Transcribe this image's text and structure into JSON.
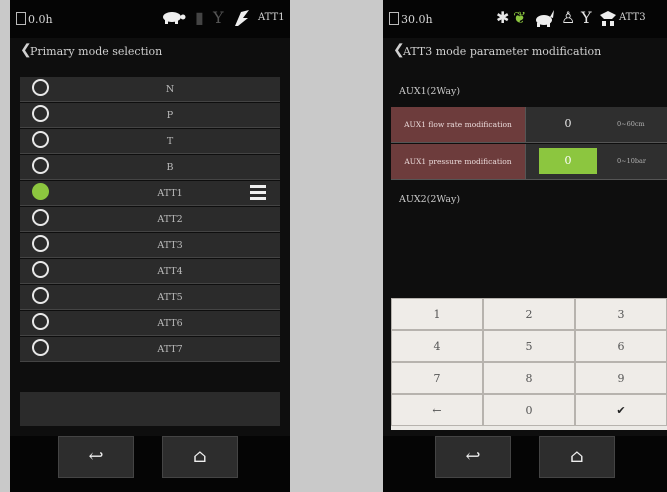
{
  "left": {
    "status": {
      "hours": "0.0h",
      "mode_tag": "ATT1",
      "icons": [
        "turtle-icon",
        "signal-bars-icon",
        "antenna-icon",
        "breaker-icon"
      ]
    },
    "title": "Primary mode selection",
    "modes": [
      {
        "label": "N",
        "selected": false
      },
      {
        "label": "P",
        "selected": false
      },
      {
        "label": "T",
        "selected": false
      },
      {
        "label": "B",
        "selected": false
      },
      {
        "label": "ATT1",
        "selected": true
      },
      {
        "label": "ATT2",
        "selected": false
      },
      {
        "label": "ATT3",
        "selected": false
      },
      {
        "label": "ATT4",
        "selected": false
      },
      {
        "label": "ATT5",
        "selected": false
      },
      {
        "label": "ATT6",
        "selected": false
      },
      {
        "label": "ATT7",
        "selected": false
      }
    ],
    "nav": {
      "back": "↩",
      "home": "⌂"
    }
  },
  "right": {
    "status": {
      "hours": "30.0h",
      "mode_tag": "ATT3",
      "icons": [
        "bluetooth-icon",
        "leaf-icon",
        "rabbit-icon",
        "operator-icon",
        "antenna-icon",
        "breaker-icon"
      ]
    },
    "title": "ATT3 mode parameter modification",
    "aux1_label": "AUX1(2Way)",
    "aux2_label": "AUX2(2Way)",
    "params": [
      {
        "name": "AUX1 flow rate modification",
        "value": "0",
        "range": "0~60cm",
        "active": false
      },
      {
        "name": "AUX1 pressure modification",
        "value": "0",
        "range": "0~10bar",
        "active": true
      }
    ],
    "keypad": [
      "1",
      "2",
      "3",
      "4",
      "5",
      "6",
      "7",
      "8",
      "9",
      "←",
      "0",
      "✔"
    ],
    "nav": {
      "back": "↩",
      "home": "⌂"
    },
    "accent": "#8cc63f"
  }
}
